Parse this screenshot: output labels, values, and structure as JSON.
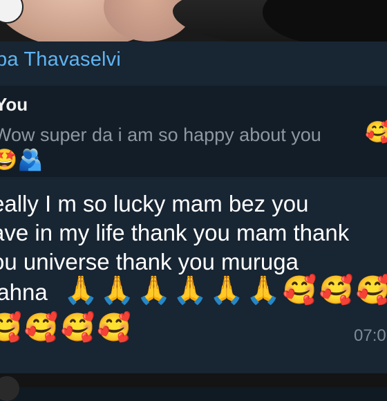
{
  "chat": {
    "sender_name": "ba Thavaselvi",
    "reply": {
      "author": "You",
      "text": "Wow super da i am so happy about you",
      "trailing_emoji": "🥰",
      "emoji_row": "🤩🫂"
    },
    "message_lines": [
      "eally I m so lucky mam bez you",
      "ave in my life thank you mam thank",
      "ou universe thank you muruga",
      "iahna"
    ],
    "emoji_line_1": "🙏🙏🙏🙏🙏🙏🥰🥰🥰",
    "emoji_line_2": "🥰🥰🥰🥰",
    "time": "07:0"
  }
}
